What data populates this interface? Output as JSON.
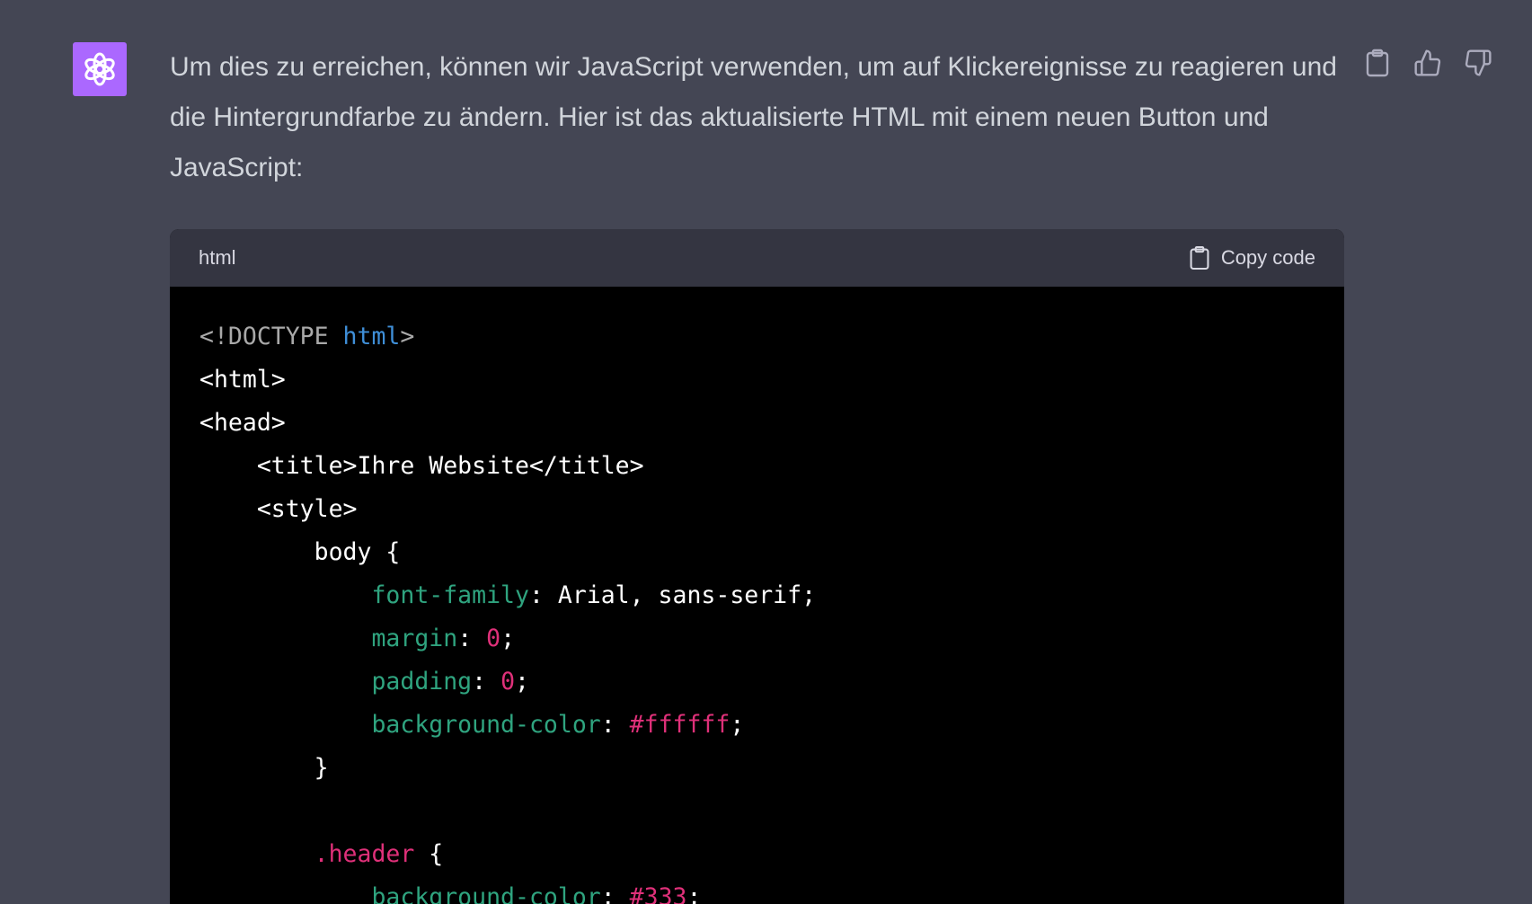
{
  "message": {
    "text": "Um dies zu erreichen, können wir JavaScript verwenden, um auf Klickereignisse zu reagieren und die Hintergrundfarbe zu ändern. Hier ist das aktualisierte HTML mit einem neuen Button und JavaScript:"
  },
  "avatar": {
    "icon": "openai-logo-icon",
    "color": "#ab68ff"
  },
  "actions": [
    {
      "name": "copy-message-button",
      "icon": "clipboard-icon"
    },
    {
      "name": "thumbs-up-button",
      "icon": "thumbs-up-icon"
    },
    {
      "name": "thumbs-down-button",
      "icon": "thumbs-down-icon"
    }
  ],
  "code_block": {
    "language": "html",
    "copy_label": "Copy code",
    "lines": [
      [
        {
          "t": "<!DOCTYPE ",
          "c": "meta"
        },
        {
          "t": "html",
          "c": "tag"
        },
        {
          "t": ">",
          "c": "meta"
        }
      ],
      [
        {
          "t": "<html>",
          "c": "plain"
        }
      ],
      [
        {
          "t": "<head>",
          "c": "plain"
        }
      ],
      [
        {
          "t": "    <title>Ihre Website</title>",
          "c": "plain"
        }
      ],
      [
        {
          "t": "    <style>",
          "c": "plain"
        }
      ],
      [
        {
          "t": "        body {",
          "c": "plain"
        }
      ],
      [
        {
          "t": "            ",
          "c": "plain"
        },
        {
          "t": "font-family",
          "c": "prop"
        },
        {
          "t": ": Arial, sans-serif;",
          "c": "plain"
        }
      ],
      [
        {
          "t": "            ",
          "c": "plain"
        },
        {
          "t": "margin",
          "c": "prop"
        },
        {
          "t": ": ",
          "c": "plain"
        },
        {
          "t": "0",
          "c": "num"
        },
        {
          "t": ";",
          "c": "plain"
        }
      ],
      [
        {
          "t": "            ",
          "c": "plain"
        },
        {
          "t": "padding",
          "c": "prop"
        },
        {
          "t": ": ",
          "c": "plain"
        },
        {
          "t": "0",
          "c": "num"
        },
        {
          "t": ";",
          "c": "plain"
        }
      ],
      [
        {
          "t": "            ",
          "c": "plain"
        },
        {
          "t": "background-color",
          "c": "prop"
        },
        {
          "t": ": ",
          "c": "plain"
        },
        {
          "t": "#ffffff",
          "c": "num"
        },
        {
          "t": ";",
          "c": "plain"
        }
      ],
      [
        {
          "t": "        }",
          "c": "plain"
        }
      ],
      [
        {
          "t": "",
          "c": "plain"
        }
      ],
      [
        {
          "t": "        ",
          "c": "plain"
        },
        {
          "t": ".header",
          "c": "sel"
        },
        {
          "t": " {",
          "c": "plain"
        }
      ],
      [
        {
          "t": "            ",
          "c": "plain"
        },
        {
          "t": "background-color",
          "c": "prop"
        },
        {
          "t": ": ",
          "c": "plain"
        },
        {
          "t": "#333",
          "c": "num"
        },
        {
          "t": ";",
          "c": "plain"
        }
      ]
    ]
  }
}
